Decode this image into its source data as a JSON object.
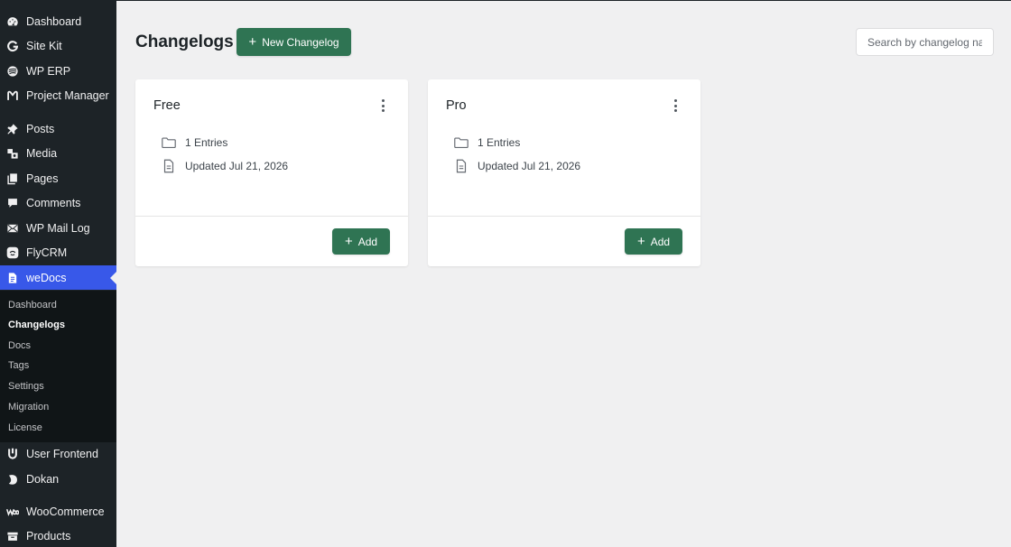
{
  "sidebar": {
    "items": [
      {
        "label": "Dashboard",
        "icon": "dashboard-icon"
      },
      {
        "label": "Site Kit",
        "icon": "google-g-icon"
      },
      {
        "label": "WP ERP",
        "icon": "erp-icon"
      },
      {
        "label": "Project Manager",
        "icon": "project-manager-icon"
      },
      {
        "label": "Posts",
        "icon": "pin-icon"
      },
      {
        "label": "Media",
        "icon": "media-icon"
      },
      {
        "label": "Pages",
        "icon": "pages-icon"
      },
      {
        "label": "Comments",
        "icon": "comment-icon"
      },
      {
        "label": "WP Mail Log",
        "icon": "mail-icon"
      },
      {
        "label": "FlyCRM",
        "icon": "flycrm-icon"
      },
      {
        "label": "weDocs",
        "icon": "document-icon"
      },
      {
        "label": "User Frontend",
        "icon": "user-frontend-icon"
      },
      {
        "label": "Dokan",
        "icon": "dokan-icon"
      },
      {
        "label": "WooCommerce",
        "icon": "woocommerce-icon"
      },
      {
        "label": "Products",
        "icon": "archive-icon"
      }
    ],
    "submenu": [
      "Dashboard",
      "Changelogs",
      "Docs",
      "Tags",
      "Settings",
      "Migration",
      "License"
    ],
    "active_item": "weDocs",
    "current_submenu": "Changelogs",
    "accent_color": "#3858e9"
  },
  "header": {
    "title": "Changelogs",
    "new_button": "New Changelog",
    "search_placeholder": "Search by changelog name"
  },
  "cards": [
    {
      "title": "Free",
      "entries": "1 Entries",
      "updated": "Updated Jul 21, 2026",
      "add_label": "Add"
    },
    {
      "title": "Pro",
      "entries": "1 Entries",
      "updated": "Updated Jul 21, 2026",
      "add_label": "Add"
    }
  ],
  "colors": {
    "primary_button": "#2f7453",
    "sidebar_bg": "#1d2327",
    "page_bg": "#f0f0f1"
  }
}
